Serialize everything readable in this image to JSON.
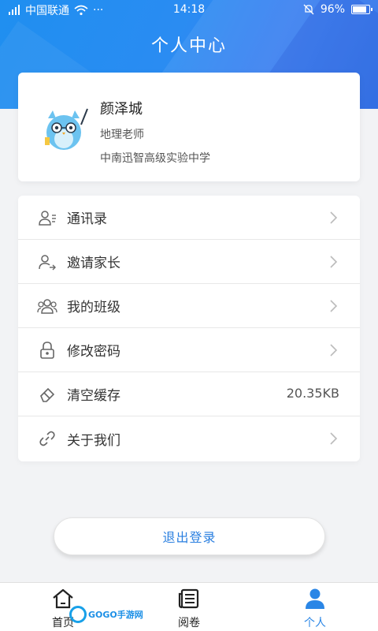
{
  "status_bar": {
    "carrier": "中国联通",
    "dots": "···",
    "time": "14:18",
    "battery": "96%",
    "battery_level": 0.96
  },
  "header": {
    "title": "个人中心"
  },
  "profile": {
    "name": "颜泽城",
    "role": "地理老师",
    "school": "中南迅智高级实验中学"
  },
  "menu": {
    "items": [
      {
        "label": "通讯录",
        "icon": "contacts-icon",
        "value": ""
      },
      {
        "label": "邀请家长",
        "icon": "invite-parent-icon",
        "value": ""
      },
      {
        "label": "我的班级",
        "icon": "class-group-icon",
        "value": ""
      },
      {
        "label": "修改密码",
        "icon": "lock-icon",
        "value": ""
      },
      {
        "label": "清空缓存",
        "icon": "eraser-icon",
        "value": "20.35KB"
      },
      {
        "label": "关于我们",
        "icon": "link-icon",
        "value": ""
      }
    ]
  },
  "logout": {
    "label": "退出登录"
  },
  "tabbar": {
    "tabs": [
      {
        "label": "首页",
        "icon": "home-icon",
        "active": false
      },
      {
        "label": "阅卷",
        "icon": "paper-icon",
        "active": false
      },
      {
        "label": "个人",
        "icon": "person-icon",
        "active": true
      }
    ]
  },
  "watermark": {
    "text": "GOGO手游网"
  },
  "colors": {
    "accent": "#2a86e6",
    "header_blue": "#2a8cf2",
    "background": "#f2f3f5"
  }
}
